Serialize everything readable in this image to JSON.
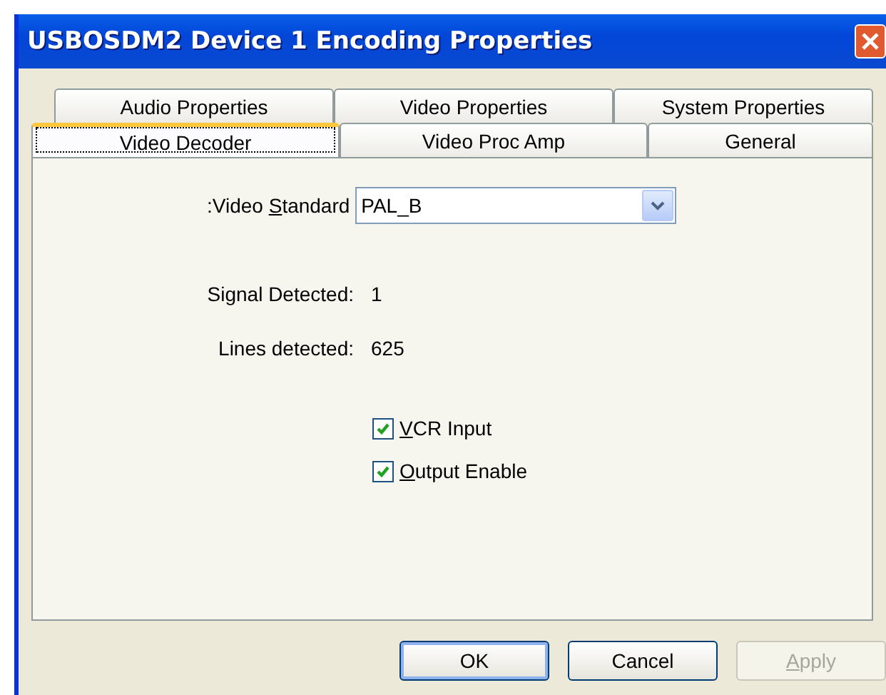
{
  "window": {
    "title": "USBOSDM2 Device 1 Encoding Properties"
  },
  "tab_rows": [
    [
      {
        "label": "Audio Properties",
        "selected": false
      },
      {
        "label": "Video Properties",
        "selected": false
      },
      {
        "label": "System Properties",
        "selected": false
      }
    ],
    [
      {
        "label": "Video Decoder",
        "selected": true
      },
      {
        "label": "Video Proc Amp",
        "selected": false
      },
      {
        "label": "General",
        "selected": false
      }
    ]
  ],
  "video_standard": {
    "label_before": ":Video ",
    "access_key": "S",
    "label_after": "tandard",
    "value": "PAL_B"
  },
  "info": [
    {
      "label": "Signal Detected:",
      "value": "1"
    },
    {
      "label": "Lines detected:",
      "value": "625"
    }
  ],
  "checkboxes": [
    {
      "access_key": "V",
      "label_after": "CR Input",
      "checked": true
    },
    {
      "access_key": "O",
      "label_after": "utput Enable",
      "checked": true
    }
  ],
  "buttons": [
    {
      "label_after": "OK",
      "disabled": false,
      "default": true
    },
    {
      "label_after": "Cancel",
      "disabled": false,
      "default": false
    },
    {
      "access_key": "A",
      "label_after": "pply",
      "disabled": true,
      "default": false
    }
  ]
}
